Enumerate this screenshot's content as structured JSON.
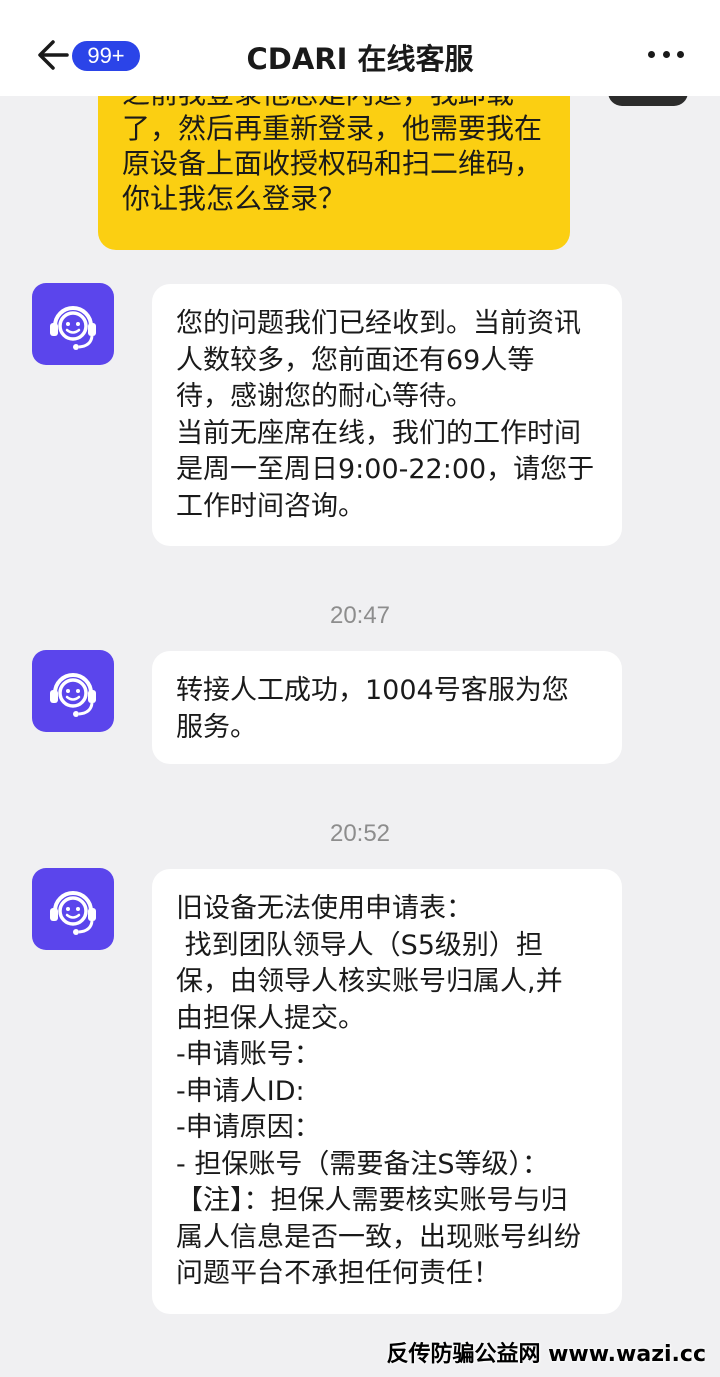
{
  "header": {
    "title": "CDARI 在线客服",
    "badge": "99+"
  },
  "messages": {
    "user_lines": [
      "之前我登录他总是闪退，我卸载",
      "了，然后再重新登录，他需要我在",
      "原设备上面收授权码和扫二维码，",
      "你让我怎么登录？"
    ],
    "agent1_lines": [
      "您的问题我们已经收到。当前资讯",
      "人数较多，您前面还有69人等",
      "待，感谢您的耐心等待。",
      "当前无座席在线，我们的工作时间",
      "是周一至周日9:00-22:00，请您于",
      "工作时间咨询。"
    ],
    "time1": "20:47",
    "agent2_lines": [
      "转接人工成功，1004号客服为您",
      "服务。"
    ],
    "time2": "20:52",
    "agent3_lines": [
      "旧设备无法使用申请表：",
      " 找到团队领导人（S5级别）担",
      "保，由领导人核实账号归属人,并",
      "由担保人提交。",
      "-申请账号：",
      "-申请人ID:",
      "-申请原因：",
      "- 担保账号（需要备注S等级）：",
      "【注】：担保人需要核实账号与归",
      "属人信息是否一致，出现账号纠纷",
      "问题平台不承担任何责任！"
    ]
  },
  "watermark": "反传防骗公益网 www.wazi.cc",
  "colors": {
    "accent": "#2b44e8",
    "user_bubble": "#fbcf12",
    "agent_avatar": "#5b45ec"
  },
  "icons": {
    "back": "back-arrow-icon",
    "more": "more-dots-icon",
    "agent": "support-agent-icon"
  }
}
